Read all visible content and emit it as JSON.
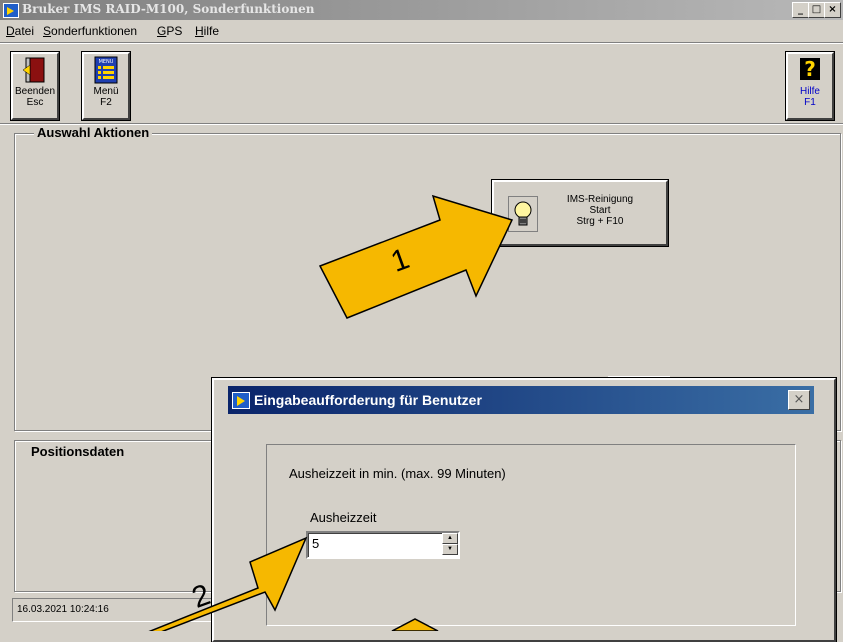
{
  "window": {
    "title": "Bruker IMS RAID-M100, Sonderfunktionen",
    "minimize": "_",
    "maximize": "□",
    "close": "×"
  },
  "menu": [
    "Datei",
    "Sonderfunktionen",
    "GPS",
    "Hilfe"
  ],
  "toolbar": {
    "exit": {
      "label": "Beenden",
      "key": "Esc"
    },
    "menu": {
      "label": "Menü",
      "key": "F2",
      "icon_text": "MENU"
    },
    "help": {
      "label": "Hilfe",
      "key": "F1"
    }
  },
  "actions_group": {
    "title": "Auswahl Aktionen"
  },
  "action_button": {
    "line1": "IMS-Reinigung",
    "line2": "Start",
    "line3": "Strg + F10"
  },
  "position_group": {
    "title": "Positionsdaten"
  },
  "status": {
    "datetime": "16.03.2021 10:24:16"
  },
  "dialog": {
    "title": "Eingabeaufforderung für Benutzer",
    "close": "×",
    "prompt": "Ausheizzeit in min. (max. 99 Minuten)",
    "field_label": "Ausheizzeit",
    "field_value": "5"
  },
  "annotations": {
    "arrow1": "1",
    "arrow2": "2",
    "arrow_color": "#f6b800"
  }
}
